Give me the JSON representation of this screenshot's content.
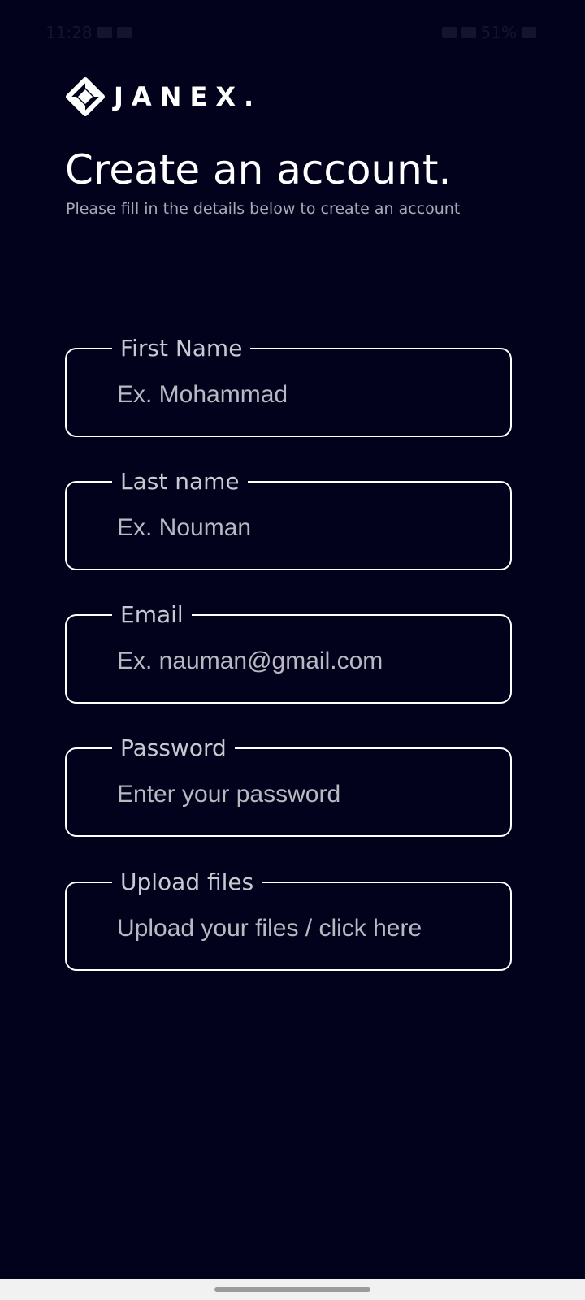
{
  "status_bar": {
    "time": "11:28",
    "battery": "51%"
  },
  "brand": {
    "name": "JANEX.",
    "logo_icon": "diamond-logo-icon"
  },
  "header": {
    "title": "Create an account.",
    "subtitle": "Please fill in the details below to create an account"
  },
  "form": {
    "first_name": {
      "label": "First Name",
      "placeholder": "Ex. Mohammad"
    },
    "last_name": {
      "label": "Last name",
      "placeholder": "Ex. Nouman"
    },
    "email": {
      "label": "Email",
      "placeholder": "Ex. nauman@gmail.com"
    },
    "password": {
      "label": "Password",
      "placeholder": "Enter your password"
    },
    "upload": {
      "label": "Upload files",
      "placeholder": "Upload your files / click here"
    }
  },
  "colors": {
    "background": "#03021d",
    "border": "#ffffff",
    "placeholder": "#b9b9c2"
  }
}
